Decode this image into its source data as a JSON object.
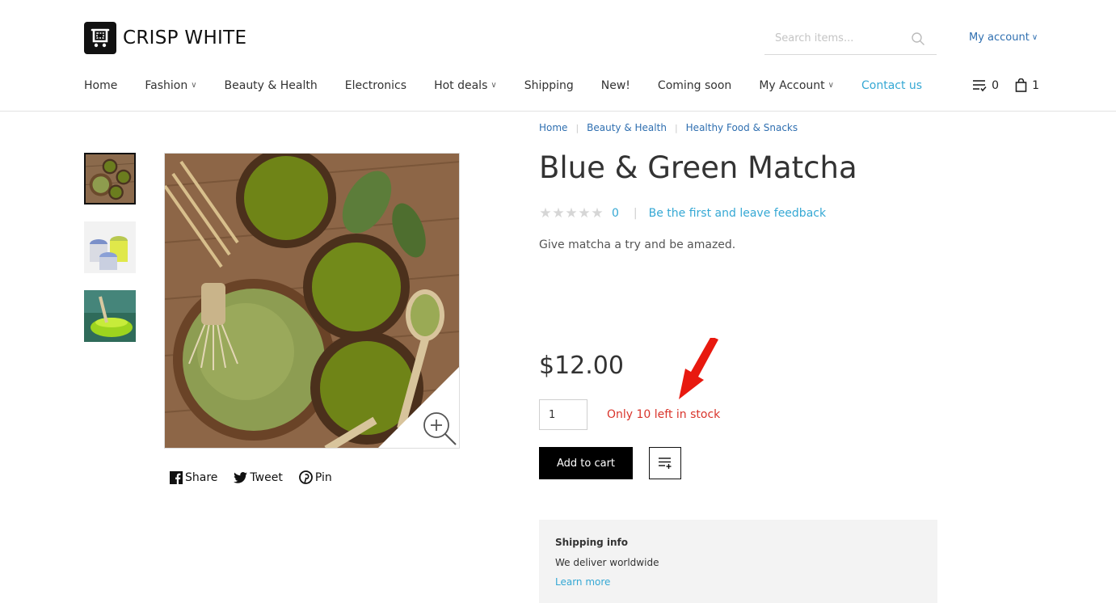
{
  "brand": {
    "name": "CRISP WHITE"
  },
  "search": {
    "placeholder": "Search items..."
  },
  "account": {
    "label": "My account"
  },
  "nav": {
    "items": [
      {
        "label": "Home",
        "dropdown": false
      },
      {
        "label": "Fashion",
        "dropdown": true
      },
      {
        "label": "Beauty & Health",
        "dropdown": false
      },
      {
        "label": "Electronics",
        "dropdown": false
      },
      {
        "label": "Hot deals",
        "dropdown": true
      },
      {
        "label": "Shipping",
        "dropdown": false
      },
      {
        "label": "New!",
        "dropdown": false
      },
      {
        "label": "Coming soon",
        "dropdown": false
      },
      {
        "label": "My Account",
        "dropdown": true
      },
      {
        "label": "Contact us",
        "dropdown": false,
        "active": true
      }
    ]
  },
  "header_icons": {
    "wishlist_count": "0",
    "cart_count": "1"
  },
  "breadcrumb": [
    "Home",
    "Beauty & Health",
    "Healthy Food & Snacks"
  ],
  "product": {
    "title": "Blue & Green Matcha",
    "rating": 0,
    "review_count": "0",
    "feedback_link": "Be the first and leave feedback",
    "description": "Give matcha a try and be amazed.",
    "price": "$12.00",
    "quantity": "1",
    "stock_message": "Only 10 left in stock",
    "add_to_cart": "Add to cart"
  },
  "social": {
    "share": "Share",
    "tweet": "Tweet",
    "pin": "Pin"
  },
  "shipping": {
    "title": "Shipping info",
    "text": "We deliver worldwide",
    "link": "Learn more"
  },
  "colors": {
    "link": "#2f6fb0",
    "accent": "#35a8d4",
    "stock_warning": "#d9342b",
    "annotation_arrow": "#e8190f"
  }
}
